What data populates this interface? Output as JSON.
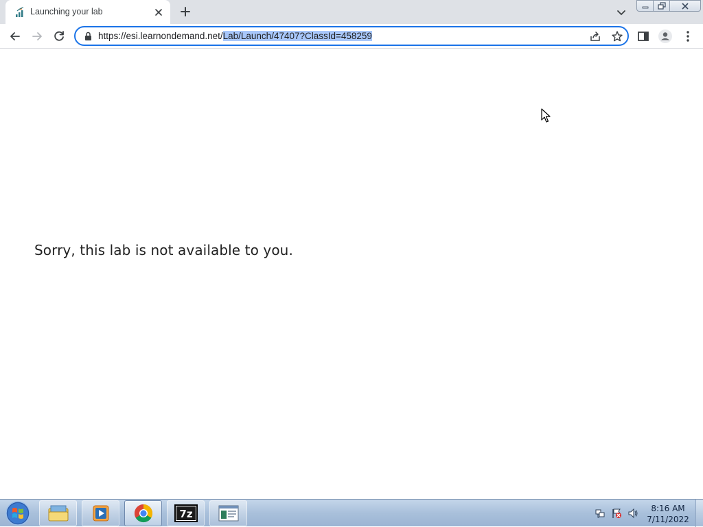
{
  "browser": {
    "tab": {
      "title": "Launching your lab"
    },
    "address": {
      "url_host": "https://esi.learnondemand.net/",
      "url_path_selected": "Lab/Launch/47407?ClassId=458259"
    }
  },
  "page": {
    "message": "Sorry, this lab is not available to you."
  },
  "taskbar": {
    "apps": [
      {
        "icon": "windows-explorer-icon"
      },
      {
        "icon": "media-player-icon"
      },
      {
        "icon": "chrome-icon"
      },
      {
        "icon": "7zip-icon",
        "label": "7z"
      },
      {
        "icon": "app-window-icon"
      }
    ],
    "clock": {
      "time": "8:16 AM",
      "date": "7/11/2022"
    }
  },
  "colors": {
    "accent": "#1a73e8",
    "selection": "#a8c7fa",
    "tabstrip": "#dee1e6",
    "taskbar": "#a9c0db"
  }
}
